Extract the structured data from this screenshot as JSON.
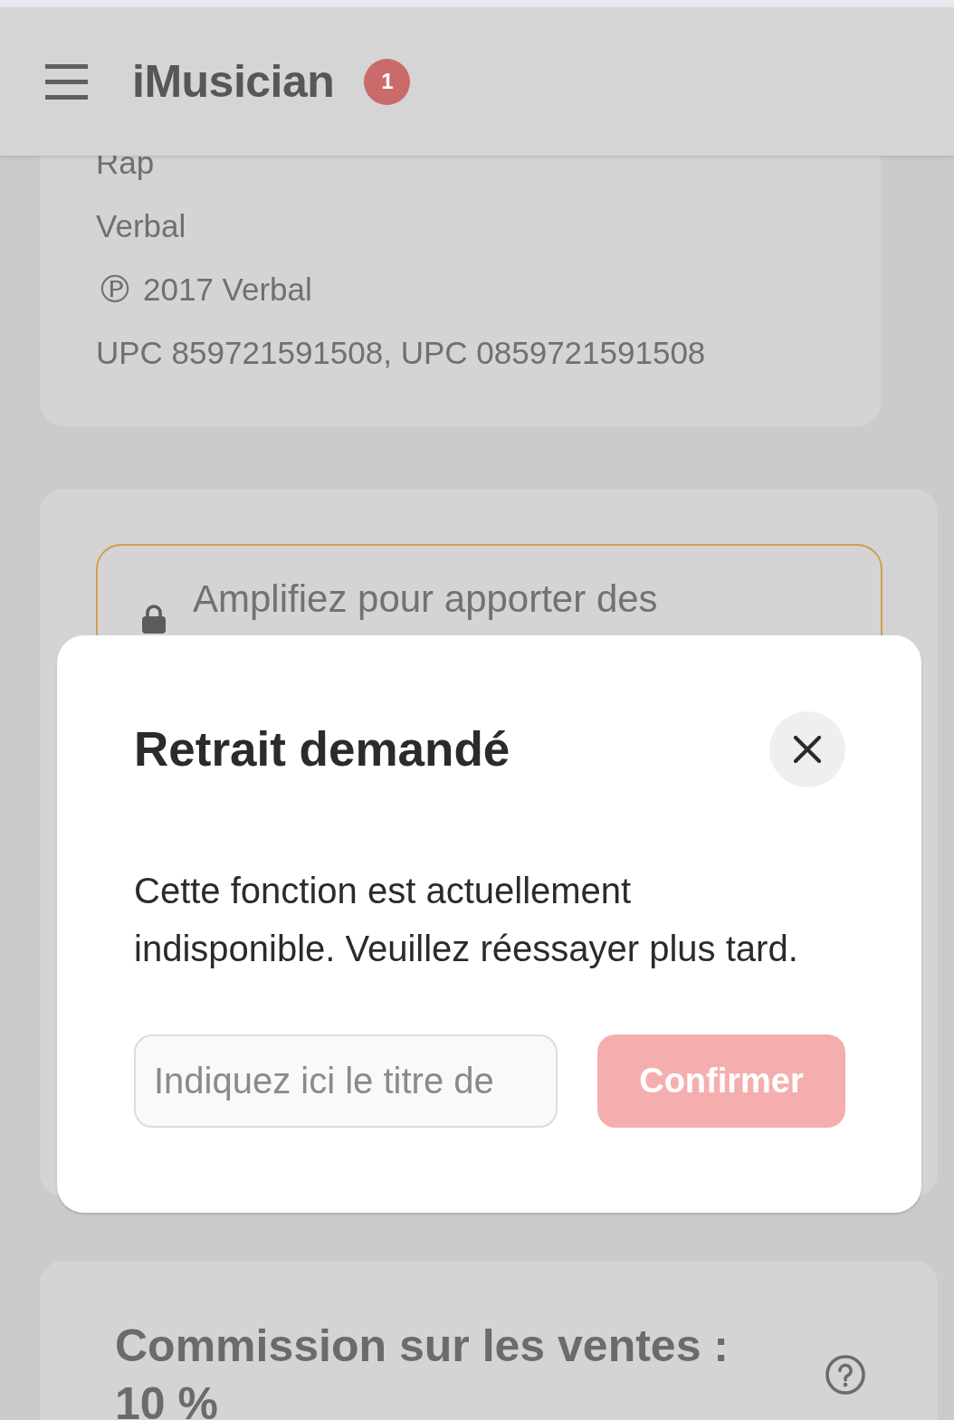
{
  "header": {
    "logo": "iMusician",
    "notification_count": "1"
  },
  "release_details": {
    "lines": [
      {
        "kind": "text",
        "text": "Rap"
      },
      {
        "kind": "text",
        "text": "Verbal"
      },
      {
        "kind": "copyright",
        "symbol": "℗",
        "text": "2017 Verbal"
      },
      {
        "kind": "text",
        "text": "UPC 859721591508, UPC 0859721591508"
      }
    ]
  },
  "upgrade_card": {
    "notice": "Amplifiez pour apporter des"
  },
  "dialog": {
    "title": "Retrait demandé",
    "message": "Cette fonction est actuellement indisponible. Veuillez réessayer plus tard.",
    "input": {
      "placeholder": "Indiquez ici le titre de"
    },
    "confirm_button": {
      "label": "Confirmer",
      "disabled": true
    }
  },
  "commission_card": {
    "title": "Commission sur les ventes : 10 %"
  }
}
